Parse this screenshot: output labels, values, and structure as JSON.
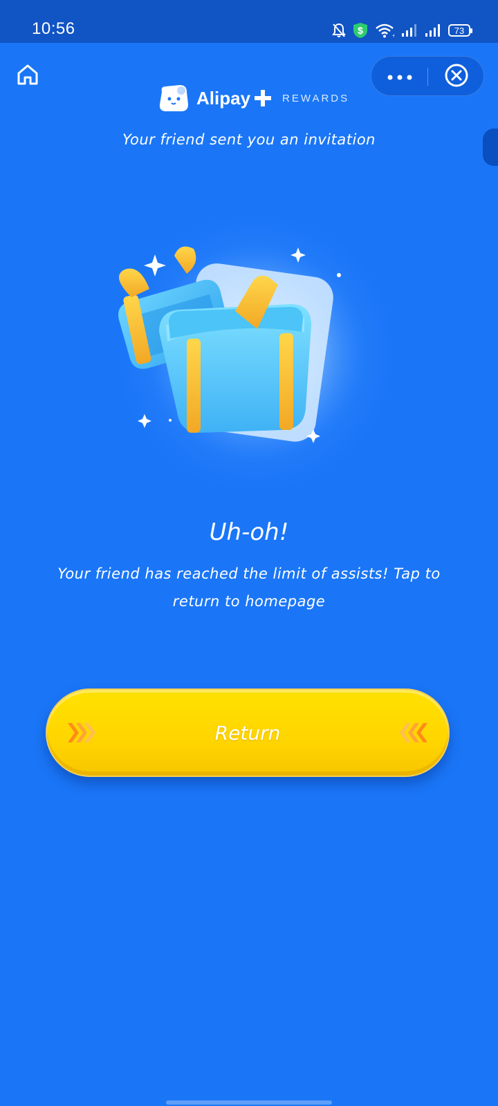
{
  "status_bar": {
    "time": "10:56",
    "battery": "73",
    "icons": [
      "bell-off-icon",
      "shield-dollar-icon",
      "wifi-icon",
      "signal-icon",
      "signal-icon",
      "battery-icon"
    ]
  },
  "header": {
    "brand_name": "Alipay",
    "brand_suffix": "REWARDS",
    "icons": [
      "home-icon",
      "more-icon",
      "close-circle-icon"
    ]
  },
  "invite_text": "Your friend sent you an invitation",
  "result": {
    "title": "Uh-oh!",
    "message": "Your friend has reached the limit of assists! Tap to return to homepage"
  },
  "return_button": {
    "label": "Return"
  },
  "colors": {
    "background": "#1a76f7",
    "status_bar": "#1154c4",
    "button": "#ffd800",
    "chevron": "#ffa21a"
  }
}
